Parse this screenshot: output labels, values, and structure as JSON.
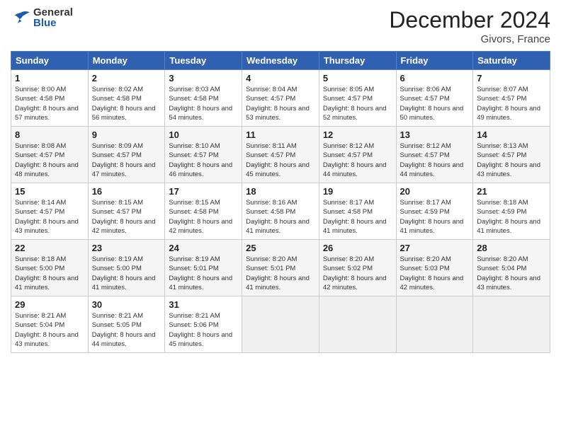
{
  "header": {
    "logo_general": "General",
    "logo_blue": "Blue",
    "month": "December 2024",
    "location": "Givors, France"
  },
  "days_of_week": [
    "Sunday",
    "Monday",
    "Tuesday",
    "Wednesday",
    "Thursday",
    "Friday",
    "Saturday"
  ],
  "weeks": [
    [
      {
        "num": "1",
        "sunrise": "8:00 AM",
        "sunset": "4:58 PM",
        "daylight": "8 hours and 57 minutes."
      },
      {
        "num": "2",
        "sunrise": "8:02 AM",
        "sunset": "4:58 PM",
        "daylight": "8 hours and 56 minutes."
      },
      {
        "num": "3",
        "sunrise": "8:03 AM",
        "sunset": "4:58 PM",
        "daylight": "8 hours and 54 minutes."
      },
      {
        "num": "4",
        "sunrise": "8:04 AM",
        "sunset": "4:57 PM",
        "daylight": "8 hours and 53 minutes."
      },
      {
        "num": "5",
        "sunrise": "8:05 AM",
        "sunset": "4:57 PM",
        "daylight": "8 hours and 52 minutes."
      },
      {
        "num": "6",
        "sunrise": "8:06 AM",
        "sunset": "4:57 PM",
        "daylight": "8 hours and 50 minutes."
      },
      {
        "num": "7",
        "sunrise": "8:07 AM",
        "sunset": "4:57 PM",
        "daylight": "8 hours and 49 minutes."
      }
    ],
    [
      {
        "num": "8",
        "sunrise": "8:08 AM",
        "sunset": "4:57 PM",
        "daylight": "8 hours and 48 minutes."
      },
      {
        "num": "9",
        "sunrise": "8:09 AM",
        "sunset": "4:57 PM",
        "daylight": "8 hours and 47 minutes."
      },
      {
        "num": "10",
        "sunrise": "8:10 AM",
        "sunset": "4:57 PM",
        "daylight": "8 hours and 46 minutes."
      },
      {
        "num": "11",
        "sunrise": "8:11 AM",
        "sunset": "4:57 PM",
        "daylight": "8 hours and 45 minutes."
      },
      {
        "num": "12",
        "sunrise": "8:12 AM",
        "sunset": "4:57 PM",
        "daylight": "8 hours and 44 minutes."
      },
      {
        "num": "13",
        "sunrise": "8:12 AM",
        "sunset": "4:57 PM",
        "daylight": "8 hours and 44 minutes."
      },
      {
        "num": "14",
        "sunrise": "8:13 AM",
        "sunset": "4:57 PM",
        "daylight": "8 hours and 43 minutes."
      }
    ],
    [
      {
        "num": "15",
        "sunrise": "8:14 AM",
        "sunset": "4:57 PM",
        "daylight": "8 hours and 43 minutes."
      },
      {
        "num": "16",
        "sunrise": "8:15 AM",
        "sunset": "4:57 PM",
        "daylight": "8 hours and 42 minutes."
      },
      {
        "num": "17",
        "sunrise": "8:15 AM",
        "sunset": "4:58 PM",
        "daylight": "8 hours and 42 minutes."
      },
      {
        "num": "18",
        "sunrise": "8:16 AM",
        "sunset": "4:58 PM",
        "daylight": "8 hours and 41 minutes."
      },
      {
        "num": "19",
        "sunrise": "8:17 AM",
        "sunset": "4:58 PM",
        "daylight": "8 hours and 41 minutes."
      },
      {
        "num": "20",
        "sunrise": "8:17 AM",
        "sunset": "4:59 PM",
        "daylight": "8 hours and 41 minutes."
      },
      {
        "num": "21",
        "sunrise": "8:18 AM",
        "sunset": "4:59 PM",
        "daylight": "8 hours and 41 minutes."
      }
    ],
    [
      {
        "num": "22",
        "sunrise": "8:18 AM",
        "sunset": "5:00 PM",
        "daylight": "8 hours and 41 minutes."
      },
      {
        "num": "23",
        "sunrise": "8:19 AM",
        "sunset": "5:00 PM",
        "daylight": "8 hours and 41 minutes."
      },
      {
        "num": "24",
        "sunrise": "8:19 AM",
        "sunset": "5:01 PM",
        "daylight": "8 hours and 41 minutes."
      },
      {
        "num": "25",
        "sunrise": "8:20 AM",
        "sunset": "5:01 PM",
        "daylight": "8 hours and 41 minutes."
      },
      {
        "num": "26",
        "sunrise": "8:20 AM",
        "sunset": "5:02 PM",
        "daylight": "8 hours and 42 minutes."
      },
      {
        "num": "27",
        "sunrise": "8:20 AM",
        "sunset": "5:03 PM",
        "daylight": "8 hours and 42 minutes."
      },
      {
        "num": "28",
        "sunrise": "8:20 AM",
        "sunset": "5:04 PM",
        "daylight": "8 hours and 43 minutes."
      }
    ],
    [
      {
        "num": "29",
        "sunrise": "8:21 AM",
        "sunset": "5:04 PM",
        "daylight": "8 hours and 43 minutes."
      },
      {
        "num": "30",
        "sunrise": "8:21 AM",
        "sunset": "5:05 PM",
        "daylight": "8 hours and 44 minutes."
      },
      {
        "num": "31",
        "sunrise": "8:21 AM",
        "sunset": "5:06 PM",
        "daylight": "8 hours and 45 minutes."
      },
      null,
      null,
      null,
      null
    ]
  ],
  "labels": {
    "sunrise": "Sunrise:",
    "sunset": "Sunset:",
    "daylight": "Daylight:"
  }
}
